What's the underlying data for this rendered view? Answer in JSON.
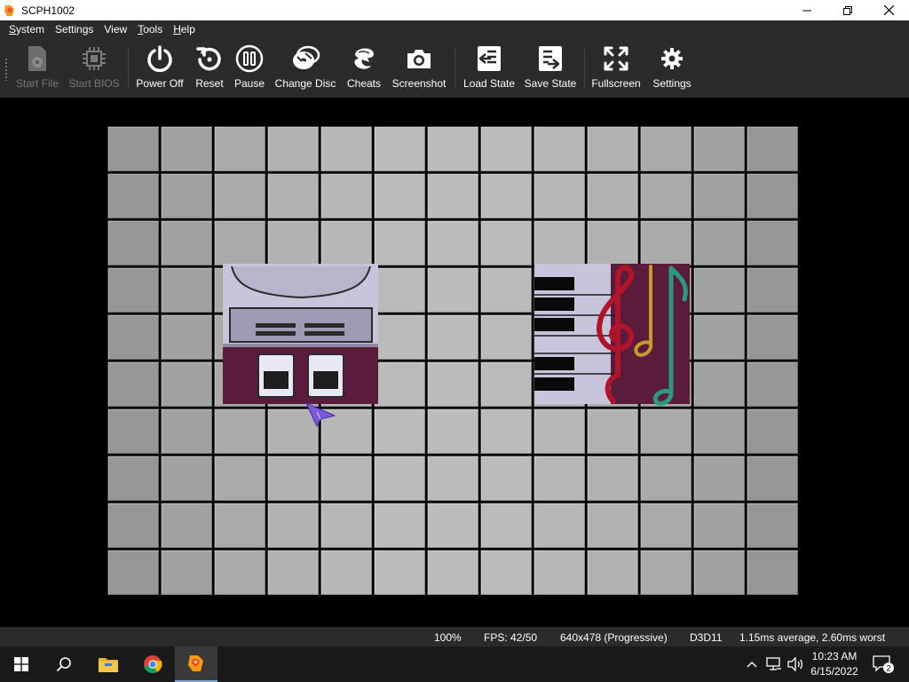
{
  "window": {
    "title": "SCPH1002",
    "icon": "duckstation-logo",
    "controls": [
      "minimize-icon",
      "maximize-icon",
      "close-icon"
    ]
  },
  "menu": [
    {
      "mnemonic": "S",
      "rest": "ystem"
    },
    {
      "mnemonic": "",
      "rest": "Settings"
    },
    {
      "mnemonic": "",
      "rest": "View"
    },
    {
      "mnemonic": "T",
      "rest": "ools"
    },
    {
      "mnemonic": "H",
      "rest": "elp"
    }
  ],
  "toolbar": {
    "buttons": [
      {
        "label": "Start File",
        "icon": "file-icon",
        "enabled": false
      },
      {
        "label": "Start BIOS",
        "icon": "chip-icon",
        "enabled": false
      },
      {
        "label": "Power Off",
        "icon": "power-icon",
        "enabled": true
      },
      {
        "label": "Reset",
        "icon": "reset-icon",
        "enabled": true
      },
      {
        "label": "Pause",
        "icon": "pause-icon",
        "enabled": true
      },
      {
        "label": "Change Disc",
        "icon": "disc-icon",
        "enabled": true
      },
      {
        "label": "Cheats",
        "icon": "cheats-icon",
        "enabled": true
      },
      {
        "label": "Screenshot",
        "icon": "camera-icon",
        "enabled": true
      },
      {
        "label": "Load State",
        "icon": "load-state-icon",
        "enabled": true
      },
      {
        "label": "Save State",
        "icon": "save-state-icon",
        "enabled": true
      },
      {
        "label": "Fullscreen",
        "icon": "fullscreen-icon",
        "enabled": true
      },
      {
        "label": "Settings",
        "icon": "gear-icon",
        "enabled": true
      }
    ]
  },
  "game_screen": {
    "panels": [
      "memory-card-manager-icon",
      "cd-player-icon"
    ]
  },
  "status": {
    "speed": "100%",
    "fps": "FPS: 42/50",
    "resolution": "640x478 (Progressive)",
    "renderer": "D3D11",
    "frame_time": "1.15ms average, 2.60ms worst"
  },
  "taskbar": {
    "apps": [
      "windows-start-icon",
      "search-icon",
      "file-explorer-icon",
      "chrome-icon",
      "duckstation-icon"
    ],
    "clock_time": "10:23 AM",
    "clock_date": "6/15/2022",
    "notification_count": "2"
  },
  "colors": {
    "chrome_bg": "#2b2b2b",
    "tile_light": "#b4b4b4",
    "tile_dark": "#7a7a7a",
    "panel_maroon": "#5a1c3a",
    "panel_lavender": "#c8c4dc"
  }
}
